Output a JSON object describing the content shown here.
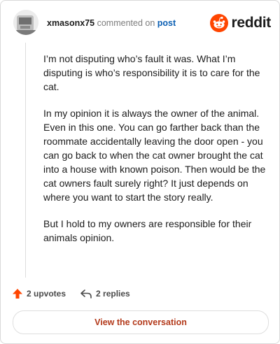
{
  "header": {
    "username": "xmasonx75",
    "commented_on_text": "commented on",
    "post_link": "post",
    "brand": "reddit"
  },
  "comment": {
    "paragraphs": [
      "I’m not disputing who’s fault it was. What I’m disputing is who’s responsibility it is to care for the cat.",
      "In my opinion it is always the owner of the animal. Even in this one. You can go farther back than the roommate accidentally leaving the door open - you can go back to when the cat owner brought the cat into a house with known poison. Then would be the cat owners fault surely right? It just depends on where you want to start the story really.",
      "But I hold to my owners are responsible for their animals opinion."
    ]
  },
  "actions": {
    "upvotes": "2 upvotes",
    "replies": "2 replies"
  },
  "cta": {
    "label": "View the conversation"
  },
  "colors": {
    "reddit_orange": "#ff4500",
    "upvote": "#ff4500",
    "link_blue": "#0b5fb3",
    "cta_text": "#b33a1b"
  }
}
